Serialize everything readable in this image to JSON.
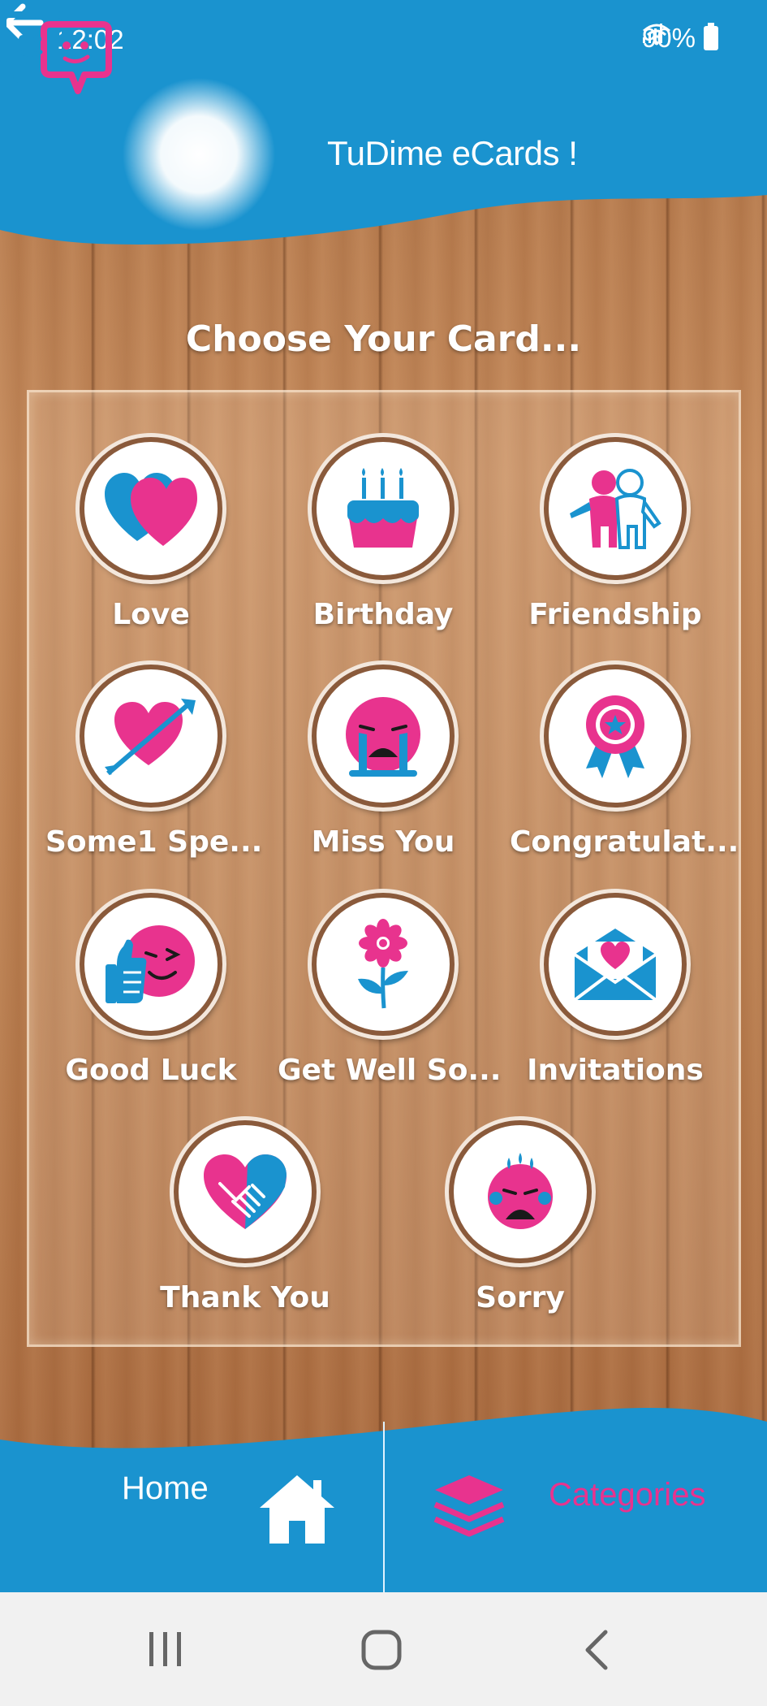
{
  "status_bar": {
    "time": "12:02",
    "battery": "90%"
  },
  "header": {
    "title": "TuDime eCards !"
  },
  "page": {
    "heading": "Choose Your Card..."
  },
  "categories": [
    {
      "label": "Love",
      "icon": "hearts-icon"
    },
    {
      "label": "Birthday",
      "icon": "cake-icon"
    },
    {
      "label": "Friendship",
      "icon": "friends-icon"
    },
    {
      "label": "Some1 Spe...",
      "icon": "heart-arrow-icon"
    },
    {
      "label": "Miss You",
      "icon": "crying-face-icon"
    },
    {
      "label": "Congratulat...",
      "icon": "award-ribbon-icon"
    },
    {
      "label": "Good Luck",
      "icon": "thumbs-up-wink-icon"
    },
    {
      "label": "Get Well So...",
      "icon": "flower-icon"
    },
    {
      "label": "Invitations",
      "icon": "envelope-heart-icon"
    },
    {
      "label": "Thank You",
      "icon": "handshake-heart-icon"
    },
    {
      "label": "Sorry",
      "icon": "sad-face-icon"
    }
  ],
  "bottom_nav": {
    "home": "Home",
    "categories": "Categories"
  },
  "colors": {
    "brand_blue": "#1a93cf",
    "brand_pink": "#e8338e",
    "wood": "#b97e50"
  }
}
